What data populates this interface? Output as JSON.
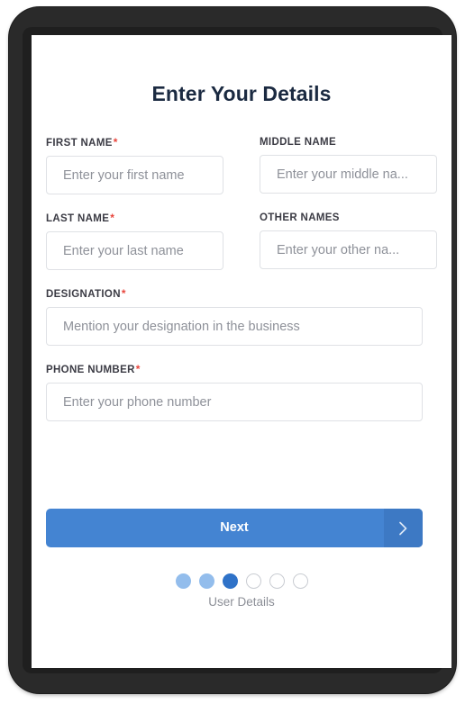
{
  "screen": {
    "title": "Enter Your Details"
  },
  "form": {
    "rows": [
      {
        "left": {
          "label": "FIRST NAME",
          "required": true,
          "placeholder": "Enter your first name",
          "value": ""
        },
        "right": {
          "label": "MIDDLE NAME",
          "required": false,
          "placeholder": "Enter your middle na...",
          "value": ""
        }
      },
      {
        "left": {
          "label": "LAST NAME",
          "required": true,
          "placeholder": "Enter your last name",
          "value": ""
        },
        "right": {
          "label": "OTHER NAMES",
          "required": false,
          "placeholder": "Enter your other na...",
          "value": ""
        }
      }
    ],
    "designation": {
      "label": "DESIGNATION",
      "required": true,
      "placeholder": "Mention your designation in the business",
      "value": ""
    },
    "phone": {
      "label": "PHONE NUMBER",
      "required": true,
      "placeholder": "Enter your phone number",
      "value": ""
    },
    "required_marker": "*"
  },
  "actions": {
    "next_label": "Next",
    "next_arrow_icon": "chevron-right-icon"
  },
  "stepper": {
    "total_steps": 6,
    "current_step": 3,
    "caption": "User Details",
    "states": [
      "done",
      "done",
      "active",
      "todo",
      "todo",
      "todo"
    ]
  },
  "colors": {
    "primary_blue": "#4484d2",
    "primary_blue_dark": "#3d79c4",
    "step_done": "#93bdec",
    "step_active": "#2f72c8",
    "step_todo_border": "#c9ccd2",
    "required_red": "#e8453c",
    "title_text": "#1b2a41",
    "label_text": "#3b3b44",
    "placeholder_text": "#8e9199",
    "input_border": "#dfe1e5",
    "device_frame": "#2a2a2a",
    "screen_background": "#ffffff"
  }
}
